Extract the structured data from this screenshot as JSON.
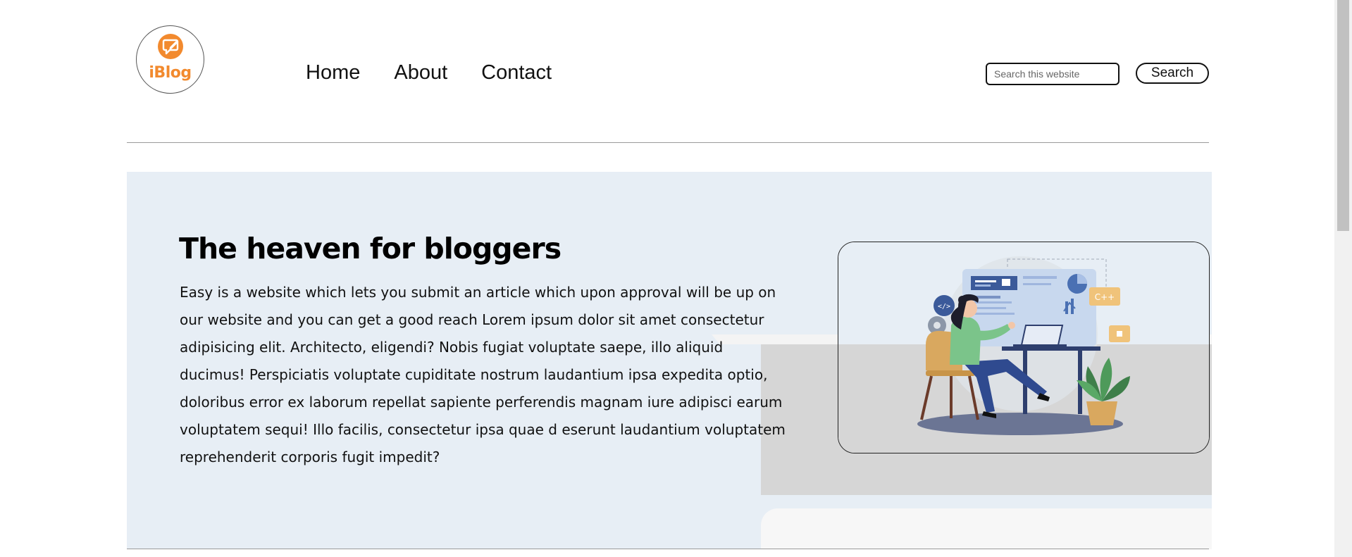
{
  "logo": {
    "icon": "chat-edit-icon",
    "text": "iBlog",
    "color": "#f28a2e"
  },
  "nav": {
    "items": [
      {
        "label": "Home"
      },
      {
        "label": "About"
      },
      {
        "label": "Contact"
      }
    ]
  },
  "search": {
    "placeholder": "Search this website",
    "value": "",
    "button_label": "Search"
  },
  "hero": {
    "title": "The heaven for bloggers",
    "text": "Easy is a website which lets you submit an article which upon approval will be up on our website and you can get a good reach Lorem ipsum dolor sit amet consectetur adipisicing elit. Architecto, eligendi? Nobis fugiat voluptate saepe, illo aliquid ducimus! Perspiciatis voluptate cupiditate nostrum laudantium ipsa expedita optio, doloribus error ex laborum repellat sapiente perferendis magnam iure adipisci earum voluptatem sequi! Illo facilis, consectetur ipsa quae d eserunt laudantium voluptatem reprehenderit corporis fugit impedit?",
    "background": "#e7eef5",
    "illustration": "woman-at-laptop-illustration",
    "illustration_badges": [
      "</>",
      "C++"
    ]
  }
}
